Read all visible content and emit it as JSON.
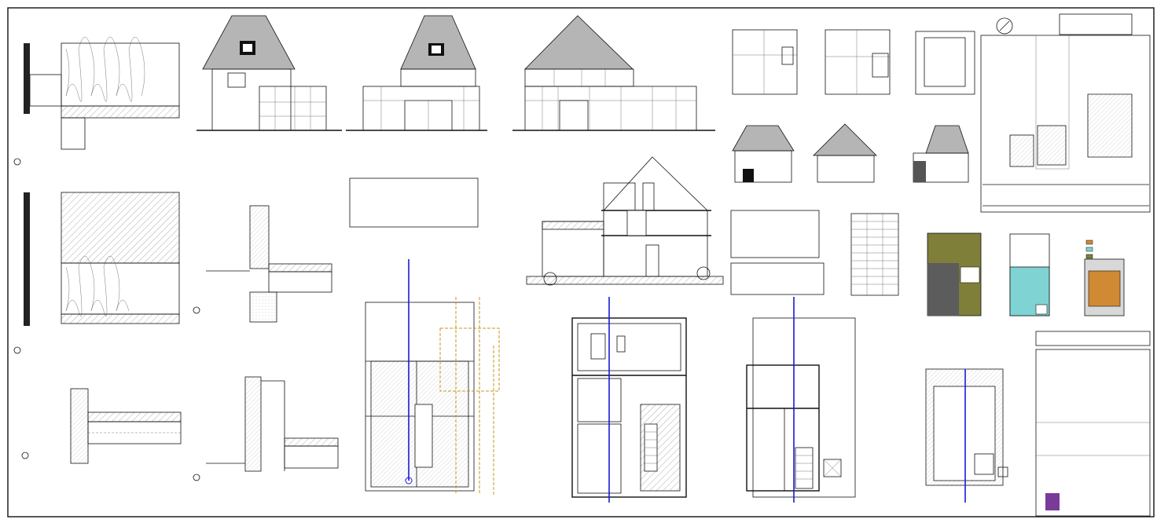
{
  "sheet": {
    "colors": {
      "line": "#111111",
      "roof": "#b5b5b5",
      "hatch": "#9a9a9a",
      "olive": "#7f7f3a",
      "cyan": "#7fd3d3",
      "orange": "#d08a34",
      "blue": "#1a1ad6",
      "gold": "#c8961e"
    }
  }
}
